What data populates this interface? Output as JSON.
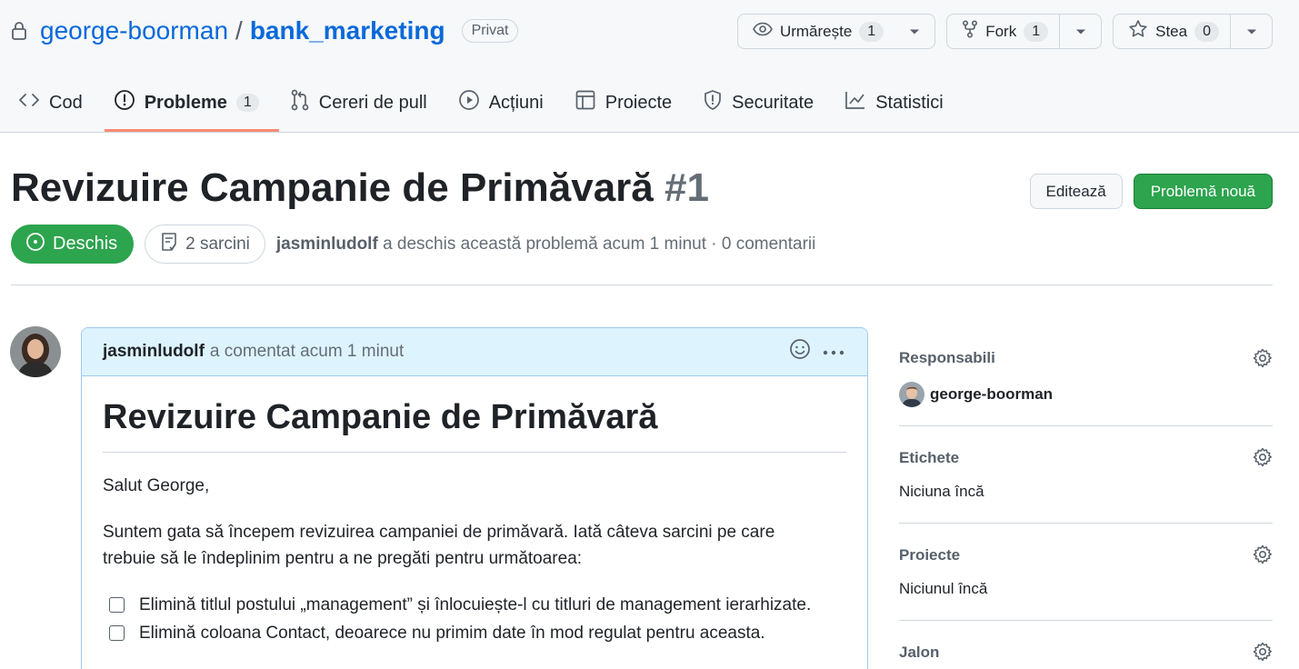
{
  "repo": {
    "owner": "george-boorman",
    "separator": "/",
    "name": "bank_marketing",
    "visibility": "Privat"
  },
  "repo_actions": {
    "watch": {
      "label": "Urmărește",
      "count": "1"
    },
    "fork": {
      "label": "Fork",
      "count": "1"
    },
    "star": {
      "label": "Stea",
      "count": "0"
    }
  },
  "tabs": [
    {
      "label": "Cod",
      "icon": "code-icon"
    },
    {
      "label": "Probleme",
      "icon": "issue-opened-icon",
      "count": "1",
      "active": true
    },
    {
      "label": "Cereri de pull",
      "icon": "git-pull-request-icon"
    },
    {
      "label": "Acțiuni",
      "icon": "play-icon"
    },
    {
      "label": "Proiecte",
      "icon": "table-icon"
    },
    {
      "label": "Securitate",
      "icon": "shield-icon"
    },
    {
      "label": "Statistici",
      "icon": "graph-icon"
    }
  ],
  "issue": {
    "title": "Revizuire Campanie de Primăvară",
    "number": "#1",
    "edit_label": "Editează",
    "new_issue_label": "Problemă nouă",
    "state": "Deschis",
    "tasks": "2 sarcini",
    "author": "jasminludolf",
    "meta": "a deschis această problemă acum 1 minut · 0 comentarii"
  },
  "comment": {
    "author": "jasminludolf",
    "meta": "a comentat acum 1 minut",
    "heading": "Revizuire Campanie de Primăvară",
    "greeting": "Salut George,",
    "intro": "Suntem gata să începem revizuirea campaniei de primăvară. Iată câteva sarcini pe care trebuie să le îndeplinim pentru a ne pregăti pentru următoarea:",
    "tasks": [
      "Elimină titlul postului „management” și înlocuiește-l cu titluri de management ierarhizate.",
      "Elimină coloana Contact, deoarece nu primim date în mod regulat pentru aceasta."
    ]
  },
  "sidebar": {
    "assignees": {
      "heading": "Responsabili",
      "user": "george-boorman"
    },
    "labels": {
      "heading": "Etichete",
      "value": "Niciuna încă"
    },
    "projects": {
      "heading": "Proiecte",
      "value": "Niciunul încă"
    },
    "milestone": {
      "heading": "Jalon"
    }
  },
  "colors": {
    "link": "#0969da",
    "open_green": "#2da44e",
    "active_tab_underline": "#fd8c73",
    "comment_header": "#ddf4ff"
  }
}
